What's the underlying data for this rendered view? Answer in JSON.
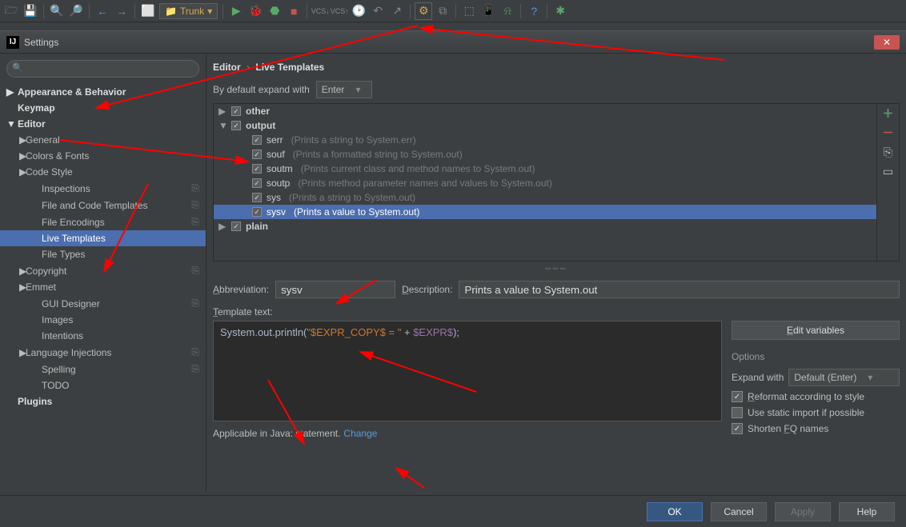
{
  "toolbar": {
    "config": "Trunk"
  },
  "dialog": {
    "title": "Settings"
  },
  "breadcrumb": {
    "root": "Editor",
    "leaf": "Live Templates"
  },
  "expand_row": {
    "label": "By default expand with",
    "value": "Enter"
  },
  "sidebar": {
    "items": [
      {
        "label": "Appearance & Behavior",
        "bold": true,
        "arrow": "▶"
      },
      {
        "label": "Keymap",
        "bold": true
      },
      {
        "label": "Editor",
        "bold": true,
        "arrow": "▼"
      },
      {
        "label": "General",
        "lvl": 1,
        "arrow": "▶"
      },
      {
        "label": "Colors & Fonts",
        "lvl": 1,
        "arrow": "▶"
      },
      {
        "label": "Code Style",
        "lvl": 1,
        "arrow": "▶"
      },
      {
        "label": "Inspections",
        "lvl": 2,
        "badge": "⎘"
      },
      {
        "label": "File and Code Templates",
        "lvl": 2,
        "badge": "⎘"
      },
      {
        "label": "File Encodings",
        "lvl": 2,
        "badge": "⎘"
      },
      {
        "label": "Live Templates",
        "lvl": 2,
        "selected": true
      },
      {
        "label": "File Types",
        "lvl": 2
      },
      {
        "label": "Copyright",
        "lvl": 1,
        "arrow": "▶",
        "badge": "⎘"
      },
      {
        "label": "Emmet",
        "lvl": 1,
        "arrow": "▶"
      },
      {
        "label": "GUI Designer",
        "lvl": 2,
        "badge": "⎘"
      },
      {
        "label": "Images",
        "lvl": 2
      },
      {
        "label": "Intentions",
        "lvl": 2
      },
      {
        "label": "Language Injections",
        "lvl": 1,
        "arrow": "▶",
        "badge": "⎘"
      },
      {
        "label": "Spelling",
        "lvl": 2,
        "badge": "⎘"
      },
      {
        "label": "TODO",
        "lvl": 2
      },
      {
        "label": "Plugins",
        "bold": true
      }
    ]
  },
  "templates": {
    "groups": [
      {
        "name": "other",
        "arrow": "▶"
      },
      {
        "name": "output",
        "arrow": "▼",
        "items": [
          {
            "name": "serr",
            "desc": "(Prints a string to System.err)"
          },
          {
            "name": "souf",
            "desc": "(Prints a formatted string to System.out)"
          },
          {
            "name": "soutm",
            "desc": "(Prints current class and method names to System.out)"
          },
          {
            "name": "soutp",
            "desc": "(Prints method parameter names and values to System.out)"
          },
          {
            "name": "sys",
            "desc": "(Prints a string to System.out)"
          },
          {
            "name": "sysv",
            "desc": "(Prints a value to System.out)",
            "selected": true
          }
        ]
      },
      {
        "name": "plain",
        "arrow": "▶"
      }
    ]
  },
  "form": {
    "abbr_label": "Abbreviation:",
    "abbr_value": "sysv",
    "desc_label": "Description:",
    "desc_value": "Prints a value to System.out",
    "template_label": "Template text:",
    "template_code": {
      "pre": "System.out.println(",
      "str": "\"$EXPR_COPY$ = \"",
      "mid": " + ",
      "var": "$EXPR$",
      "post": ");"
    },
    "edit_vars": "Edit variables",
    "options_title": "Options",
    "expand_with_label": "Expand with",
    "expand_with_value": "Default (Enter)",
    "opt1": "Reformat according to style",
    "opt2": "Use static import if possible",
    "opt3": "Shorten FQ names",
    "applicable": "Applicable in Java: statement.",
    "change": "Change"
  },
  "footer": {
    "ok": "OK",
    "cancel": "Cancel",
    "apply": "Apply",
    "help": "Help"
  }
}
